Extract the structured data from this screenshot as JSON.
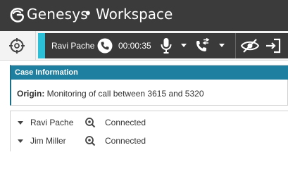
{
  "app": {
    "brand": "Genesys",
    "separator": "•",
    "product": "Workspace"
  },
  "callbar": {
    "caller": "Ravi Pache",
    "timer": "00:00:35",
    "accent_color": "#2bc0d8"
  },
  "icons": {
    "target": "target-icon",
    "phone": "phone-icon",
    "mic": "microphone-icon",
    "transfer": "phone-transfer-icon",
    "eye": "eye-off-icon",
    "exit": "sign-out-icon",
    "connected": "connected-icon"
  },
  "case": {
    "header": "Case Information",
    "origin_label": "Origin:",
    "origin_value": "Monitoring of call between 3615 and 5320"
  },
  "participants": [
    {
      "name": "Ravi Pache",
      "status": "Connected"
    },
    {
      "name": "Jim Miller",
      "status": "Connected"
    }
  ]
}
